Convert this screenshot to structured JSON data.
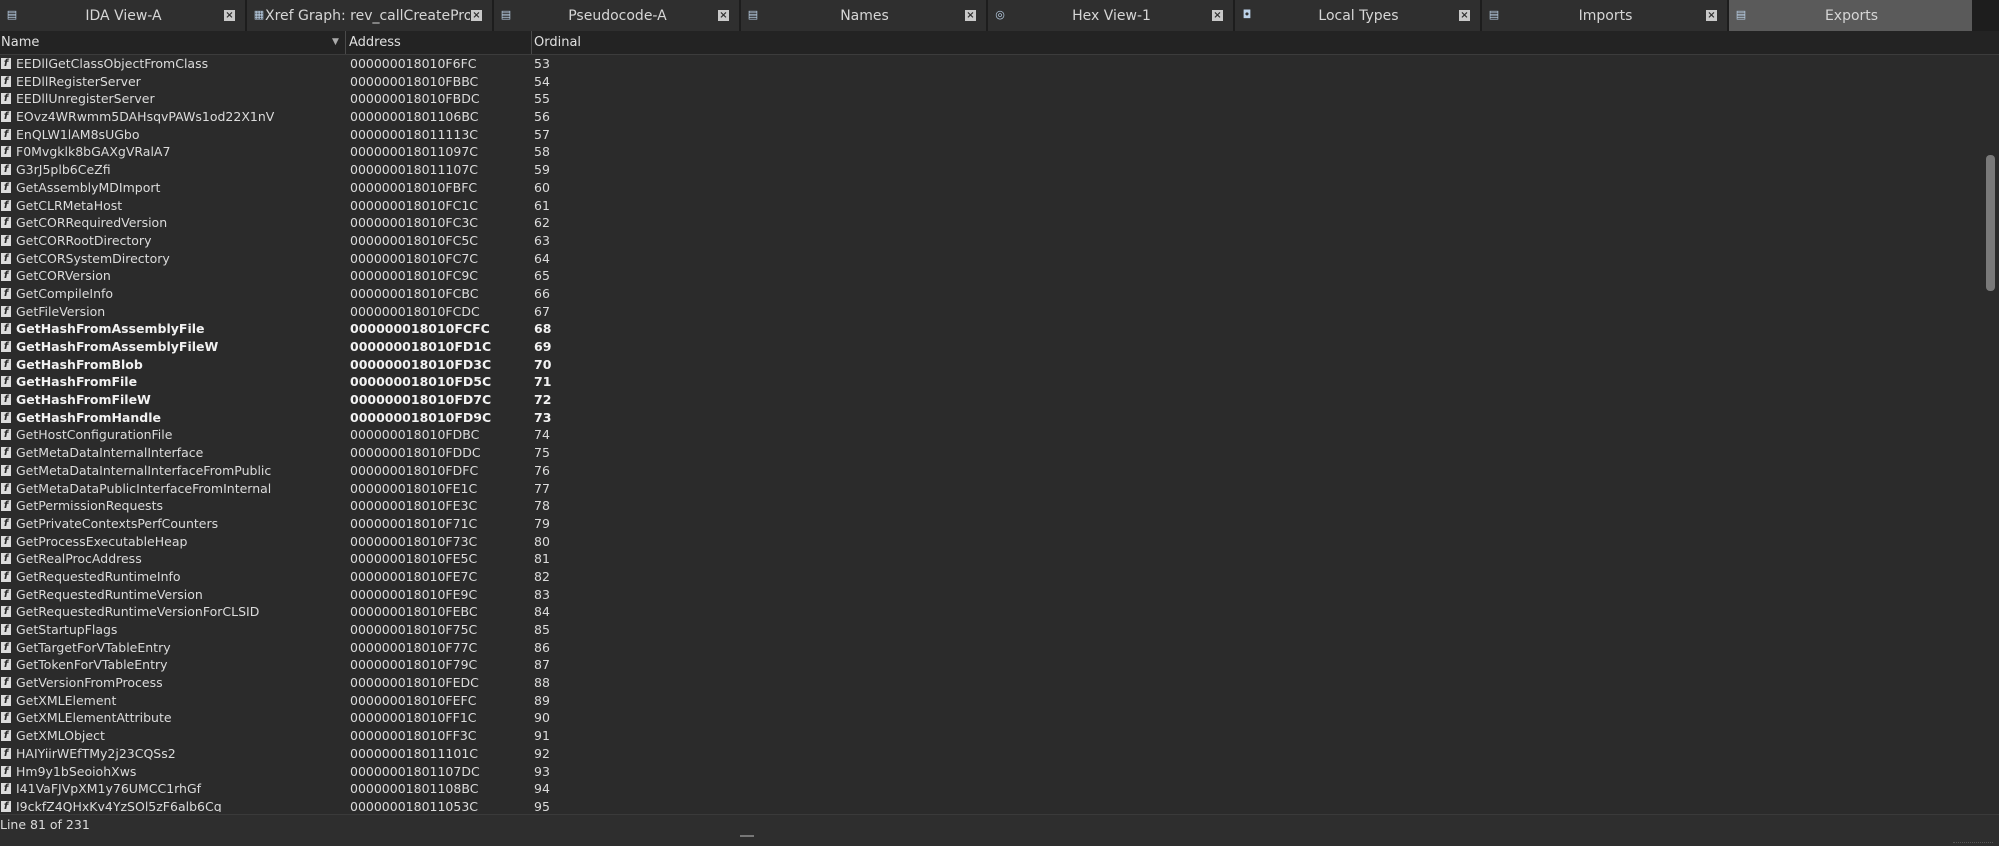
{
  "tabs": [
    {
      "label": "IDA View-A",
      "icon": "ida-view-icon",
      "glyph": "▤",
      "active": false
    },
    {
      "label": "Xref Graph: rev_callCreateProcessW",
      "icon": "xref-graph-icon",
      "glyph": "▦",
      "active": false
    },
    {
      "label": "Pseudocode-A",
      "icon": "pseudocode-icon",
      "glyph": "▤",
      "active": false
    },
    {
      "label": "Names",
      "icon": "names-icon",
      "glyph": "▤",
      "active": false
    },
    {
      "label": "Hex View-1",
      "icon": "hex-view-icon",
      "glyph": "◎",
      "active": false
    },
    {
      "label": "Local Types",
      "icon": "local-types-icon",
      "glyph": "◘",
      "active": false
    },
    {
      "label": "Imports",
      "icon": "imports-icon",
      "glyph": "▤",
      "active": false
    },
    {
      "label": "Exports",
      "icon": "exports-icon",
      "glyph": "▤",
      "active": true
    }
  ],
  "columns": {
    "name": "Name",
    "address": "Address",
    "ordinal": "Ordinal"
  },
  "rows": [
    {
      "name": "EEDllGetClassObjectFromClass",
      "address": "000000018010F6FC",
      "ordinal": "53",
      "bold": false
    },
    {
      "name": "EEDllRegisterServer",
      "address": "000000018010FBBC",
      "ordinal": "54",
      "bold": false
    },
    {
      "name": "EEDllUnregisterServer",
      "address": "000000018010FBDC",
      "ordinal": "55",
      "bold": false
    },
    {
      "name": "EOvz4WRwmm5DAHsqvPAWs1od22X1nV",
      "address": "00000001801106BC",
      "ordinal": "56",
      "bold": false
    },
    {
      "name": "EnQLW1lAM8sUGbo",
      "address": "000000018011113C",
      "ordinal": "57",
      "bold": false
    },
    {
      "name": "F0Mvgklk8bGAXgVRalA7",
      "address": "000000018011097C",
      "ordinal": "58",
      "bold": false
    },
    {
      "name": "G3rJ5plb6CeZfi",
      "address": "000000018011107C",
      "ordinal": "59",
      "bold": false
    },
    {
      "name": "GetAssemblyMDImport",
      "address": "000000018010FBFC",
      "ordinal": "60",
      "bold": false
    },
    {
      "name": "GetCLRMetaHost",
      "address": "000000018010FC1C",
      "ordinal": "61",
      "bold": false
    },
    {
      "name": "GetCORRequiredVersion",
      "address": "000000018010FC3C",
      "ordinal": "62",
      "bold": false
    },
    {
      "name": "GetCORRootDirectory",
      "address": "000000018010FC5C",
      "ordinal": "63",
      "bold": false
    },
    {
      "name": "GetCORSystemDirectory",
      "address": "000000018010FC7C",
      "ordinal": "64",
      "bold": false
    },
    {
      "name": "GetCORVersion",
      "address": "000000018010FC9C",
      "ordinal": "65",
      "bold": false
    },
    {
      "name": "GetCompileInfo",
      "address": "000000018010FCBC",
      "ordinal": "66",
      "bold": false
    },
    {
      "name": "GetFileVersion",
      "address": "000000018010FCDC",
      "ordinal": "67",
      "bold": false
    },
    {
      "name": "GetHashFromAssemblyFile",
      "address": "000000018010FCFC",
      "ordinal": "68",
      "bold": true
    },
    {
      "name": "GetHashFromAssemblyFileW",
      "address": "000000018010FD1C",
      "ordinal": "69",
      "bold": true
    },
    {
      "name": "GetHashFromBlob",
      "address": "000000018010FD3C",
      "ordinal": "70",
      "bold": true
    },
    {
      "name": "GetHashFromFile",
      "address": "000000018010FD5C",
      "ordinal": "71",
      "bold": true
    },
    {
      "name": "GetHashFromFileW",
      "address": "000000018010FD7C",
      "ordinal": "72",
      "bold": true
    },
    {
      "name": "GetHashFromHandle",
      "address": "000000018010FD9C",
      "ordinal": "73",
      "bold": true
    },
    {
      "name": "GetHostConfigurationFile",
      "address": "000000018010FDBC",
      "ordinal": "74",
      "bold": false
    },
    {
      "name": "GetMetaDataInternalInterface",
      "address": "000000018010FDDC",
      "ordinal": "75",
      "bold": false
    },
    {
      "name": "GetMetaDataInternalInterfaceFromPublic",
      "address": "000000018010FDFC",
      "ordinal": "76",
      "bold": false
    },
    {
      "name": "GetMetaDataPublicInterfaceFromInternal",
      "address": "000000018010FE1C",
      "ordinal": "77",
      "bold": false
    },
    {
      "name": "GetPermissionRequests",
      "address": "000000018010FE3C",
      "ordinal": "78",
      "bold": false
    },
    {
      "name": "GetPrivateContextsPerfCounters",
      "address": "000000018010F71C",
      "ordinal": "79",
      "bold": false
    },
    {
      "name": "GetProcessExecutableHeap",
      "address": "000000018010F73C",
      "ordinal": "80",
      "bold": false
    },
    {
      "name": "GetRealProcAddress",
      "address": "000000018010FE5C",
      "ordinal": "81",
      "bold": false
    },
    {
      "name": "GetRequestedRuntimeInfo",
      "address": "000000018010FE7C",
      "ordinal": "82",
      "bold": false
    },
    {
      "name": "GetRequestedRuntimeVersion",
      "address": "000000018010FE9C",
      "ordinal": "83",
      "bold": false
    },
    {
      "name": "GetRequestedRuntimeVersionForCLSID",
      "address": "000000018010FEBC",
      "ordinal": "84",
      "bold": false
    },
    {
      "name": "GetStartupFlags",
      "address": "000000018010F75C",
      "ordinal": "85",
      "bold": false
    },
    {
      "name": "GetTargetForVTableEntry",
      "address": "000000018010F77C",
      "ordinal": "86",
      "bold": false
    },
    {
      "name": "GetTokenForVTableEntry",
      "address": "000000018010F79C",
      "ordinal": "87",
      "bold": false
    },
    {
      "name": "GetVersionFromProcess",
      "address": "000000018010FEDC",
      "ordinal": "88",
      "bold": false
    },
    {
      "name": "GetXMLElement",
      "address": "000000018010FEFC",
      "ordinal": "89",
      "bold": false
    },
    {
      "name": "GetXMLElementAttribute",
      "address": "000000018010FF1C",
      "ordinal": "90",
      "bold": false
    },
    {
      "name": "GetXMLObject",
      "address": "000000018010FF3C",
      "ordinal": "91",
      "bold": false
    },
    {
      "name": "HAIYiirWEfTMy2j23CQSs2",
      "address": "000000018011101C",
      "ordinal": "92",
      "bold": false
    },
    {
      "name": "Hm9y1bSeoiohXws",
      "address": "00000001801107DC",
      "ordinal": "93",
      "bold": false
    },
    {
      "name": "I41VaFJVpXM1y76UMCC1rhGf",
      "address": "00000001801108BC",
      "ordinal": "94",
      "bold": false
    },
    {
      "name": "I9ckfZ4QHxKv4YzSOl5zF6alb6Cq",
      "address": "000000018011053C",
      "ordinal": "95",
      "bold": false
    }
  ],
  "status": {
    "text": "Line 81 of 231"
  }
}
